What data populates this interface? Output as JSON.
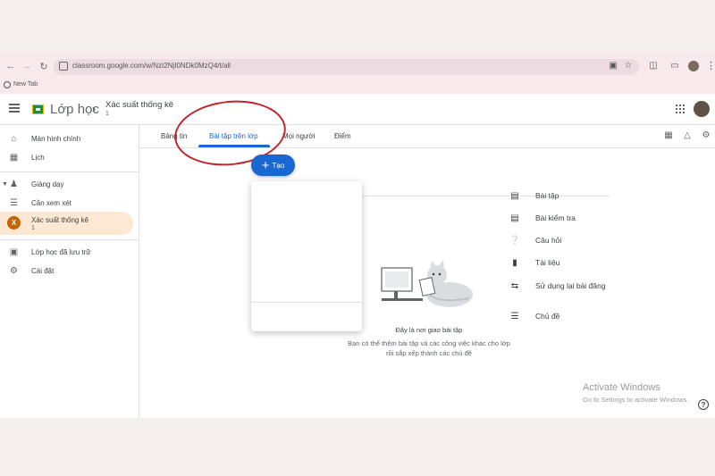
{
  "browser": {
    "url": "classroom.google.com/w/NzI2NjI0NDk0MzQ4/t/all",
    "bookmark_label": "New Tab"
  },
  "header": {
    "app_name": "Lớp học",
    "class_title": "Xác suất thống kê",
    "class_subtitle": "1"
  },
  "sidebar": {
    "home": "Màn hình chính",
    "calendar": "Lịch",
    "teaching": "Giảng dạy",
    "to_review": "Cần xem xét",
    "active_class": {
      "avatar_letter": "X",
      "title": "Xác suất thống kê",
      "subtitle": "1"
    },
    "archived": "Lớp học đã lưu trữ",
    "settings": "Cài đặt"
  },
  "tabs": [
    "Bảng tin",
    "Bài tập trên lớp",
    "Mọi người",
    "Điểm"
  ],
  "create_button": {
    "label": "Tạo"
  },
  "menu": {
    "items": [
      "Bài tập",
      "Bài kiểm tra",
      "Câu hỏi",
      "Tài liệu",
      "Sử dụng lại bài đăng"
    ],
    "topic": "Chủ đề"
  },
  "empty_state": {
    "title": "Đây là nơi giao bài tập",
    "desc_line1": "Bạn có thể thêm bài tập và các công việc khác cho lớp",
    "desc_line2": "rồi sắp xếp thành các chủ đề"
  },
  "watermark": {
    "title": "Activate Windows",
    "subtitle": "Go to Settings to activate Windows."
  },
  "colors": {
    "accent": "#1967d2",
    "annotation": "#c0272d",
    "active_class_bg": "#fde8d4",
    "class_avatar": "#c26401"
  }
}
